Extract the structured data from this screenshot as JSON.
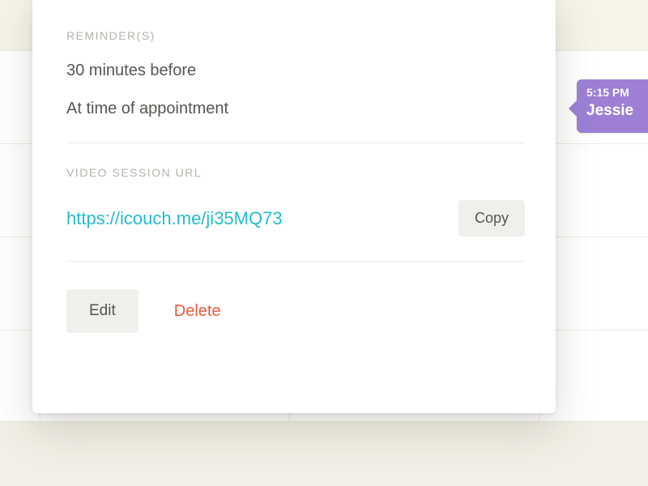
{
  "appointment": {
    "time": "5:15 PM",
    "name": "Jessie"
  },
  "popover": {
    "reminders_label": "REMINDER(S)",
    "reminders": [
      "30 minutes before",
      "At time of appointment"
    ],
    "video_label": "VIDEO SESSION URL",
    "video_url": "https://icouch.me/ji35MQ73",
    "copy_label": "Copy",
    "edit_label": "Edit",
    "delete_label": "Delete"
  }
}
